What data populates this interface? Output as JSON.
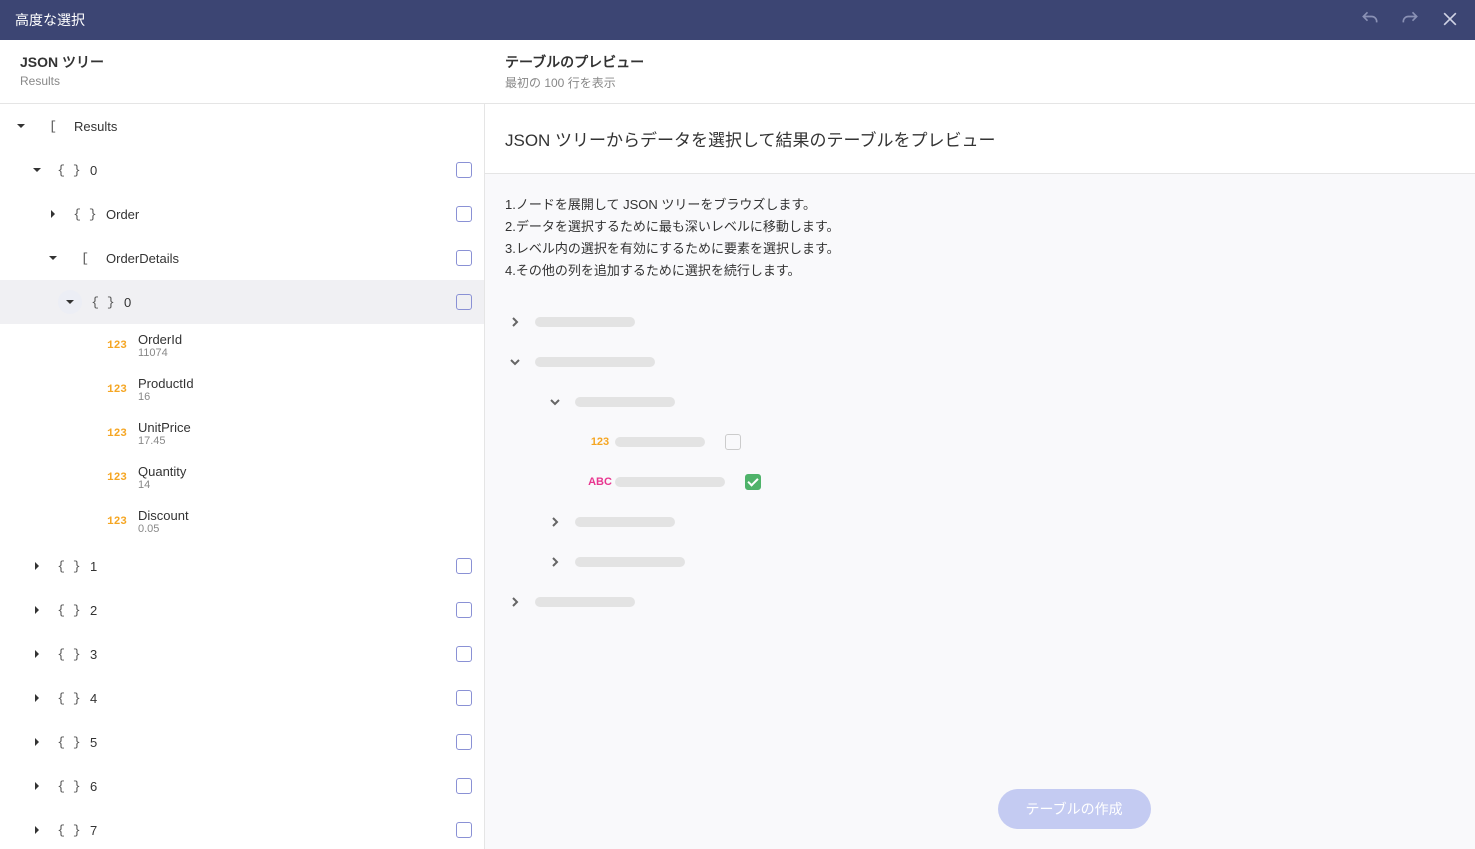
{
  "titlebar": {
    "title": "高度な選択"
  },
  "header": {
    "left": {
      "title": "JSON ツリー",
      "sub": "Results"
    },
    "right": {
      "title": "テーブルのプレビュー",
      "sub": "最初の 100 行を表示"
    }
  },
  "tree": [
    {
      "indent": 0,
      "expanded": true,
      "type": "[",
      "label": "Results",
      "checkbox": false
    },
    {
      "indent": 1,
      "expanded": true,
      "type": "{ }",
      "label": "0",
      "checkbox": true
    },
    {
      "indent": 2,
      "expanded": false,
      "type": "{ }",
      "label": "Order",
      "checkbox": true
    },
    {
      "indent": 2,
      "expanded": true,
      "type": "[",
      "label": "OrderDetails",
      "checkbox": true
    },
    {
      "indent": 3,
      "expanded": true,
      "circled": true,
      "type": "{ }",
      "label": "0",
      "checkbox": true,
      "selected": true
    },
    {
      "indent": 4,
      "expanded": null,
      "type": "123",
      "label": "OrderId",
      "value": "11074",
      "checkbox": false
    },
    {
      "indent": 4,
      "expanded": null,
      "type": "123",
      "label": "ProductId",
      "value": "16",
      "checkbox": false
    },
    {
      "indent": 4,
      "expanded": null,
      "type": "123",
      "label": "UnitPrice",
      "value": "17.45",
      "checkbox": false
    },
    {
      "indent": 4,
      "expanded": null,
      "type": "123",
      "label": "Quantity",
      "value": "14",
      "checkbox": false
    },
    {
      "indent": 4,
      "expanded": null,
      "type": "123",
      "label": "Discount",
      "value": "0.05",
      "checkbox": false
    },
    {
      "indent": 1,
      "expanded": false,
      "type": "{ }",
      "label": "1",
      "checkbox": true
    },
    {
      "indent": 1,
      "expanded": false,
      "type": "{ }",
      "label": "2",
      "checkbox": true
    },
    {
      "indent": 1,
      "expanded": false,
      "type": "{ }",
      "label": "3",
      "checkbox": true
    },
    {
      "indent": 1,
      "expanded": false,
      "type": "{ }",
      "label": "4",
      "checkbox": true
    },
    {
      "indent": 1,
      "expanded": false,
      "type": "{ }",
      "label": "5",
      "checkbox": true
    },
    {
      "indent": 1,
      "expanded": false,
      "type": "{ }",
      "label": "6",
      "checkbox": true
    },
    {
      "indent": 1,
      "expanded": false,
      "type": "{ }",
      "label": "7",
      "checkbox": true
    }
  ],
  "preview": {
    "title": "JSON ツリーからデータを選択して結果のテーブルをプレビュー",
    "instructions": [
      "1.ノードを展開して JSON ツリーをブラウズします。",
      "2.データを選択するために最も深いレベルに移動します。",
      "3.レベル内の選択を有効にするために要素を選択します。",
      "4.その他の列を追加するために選択を続行します。"
    ],
    "button": "テーブルの作成"
  }
}
